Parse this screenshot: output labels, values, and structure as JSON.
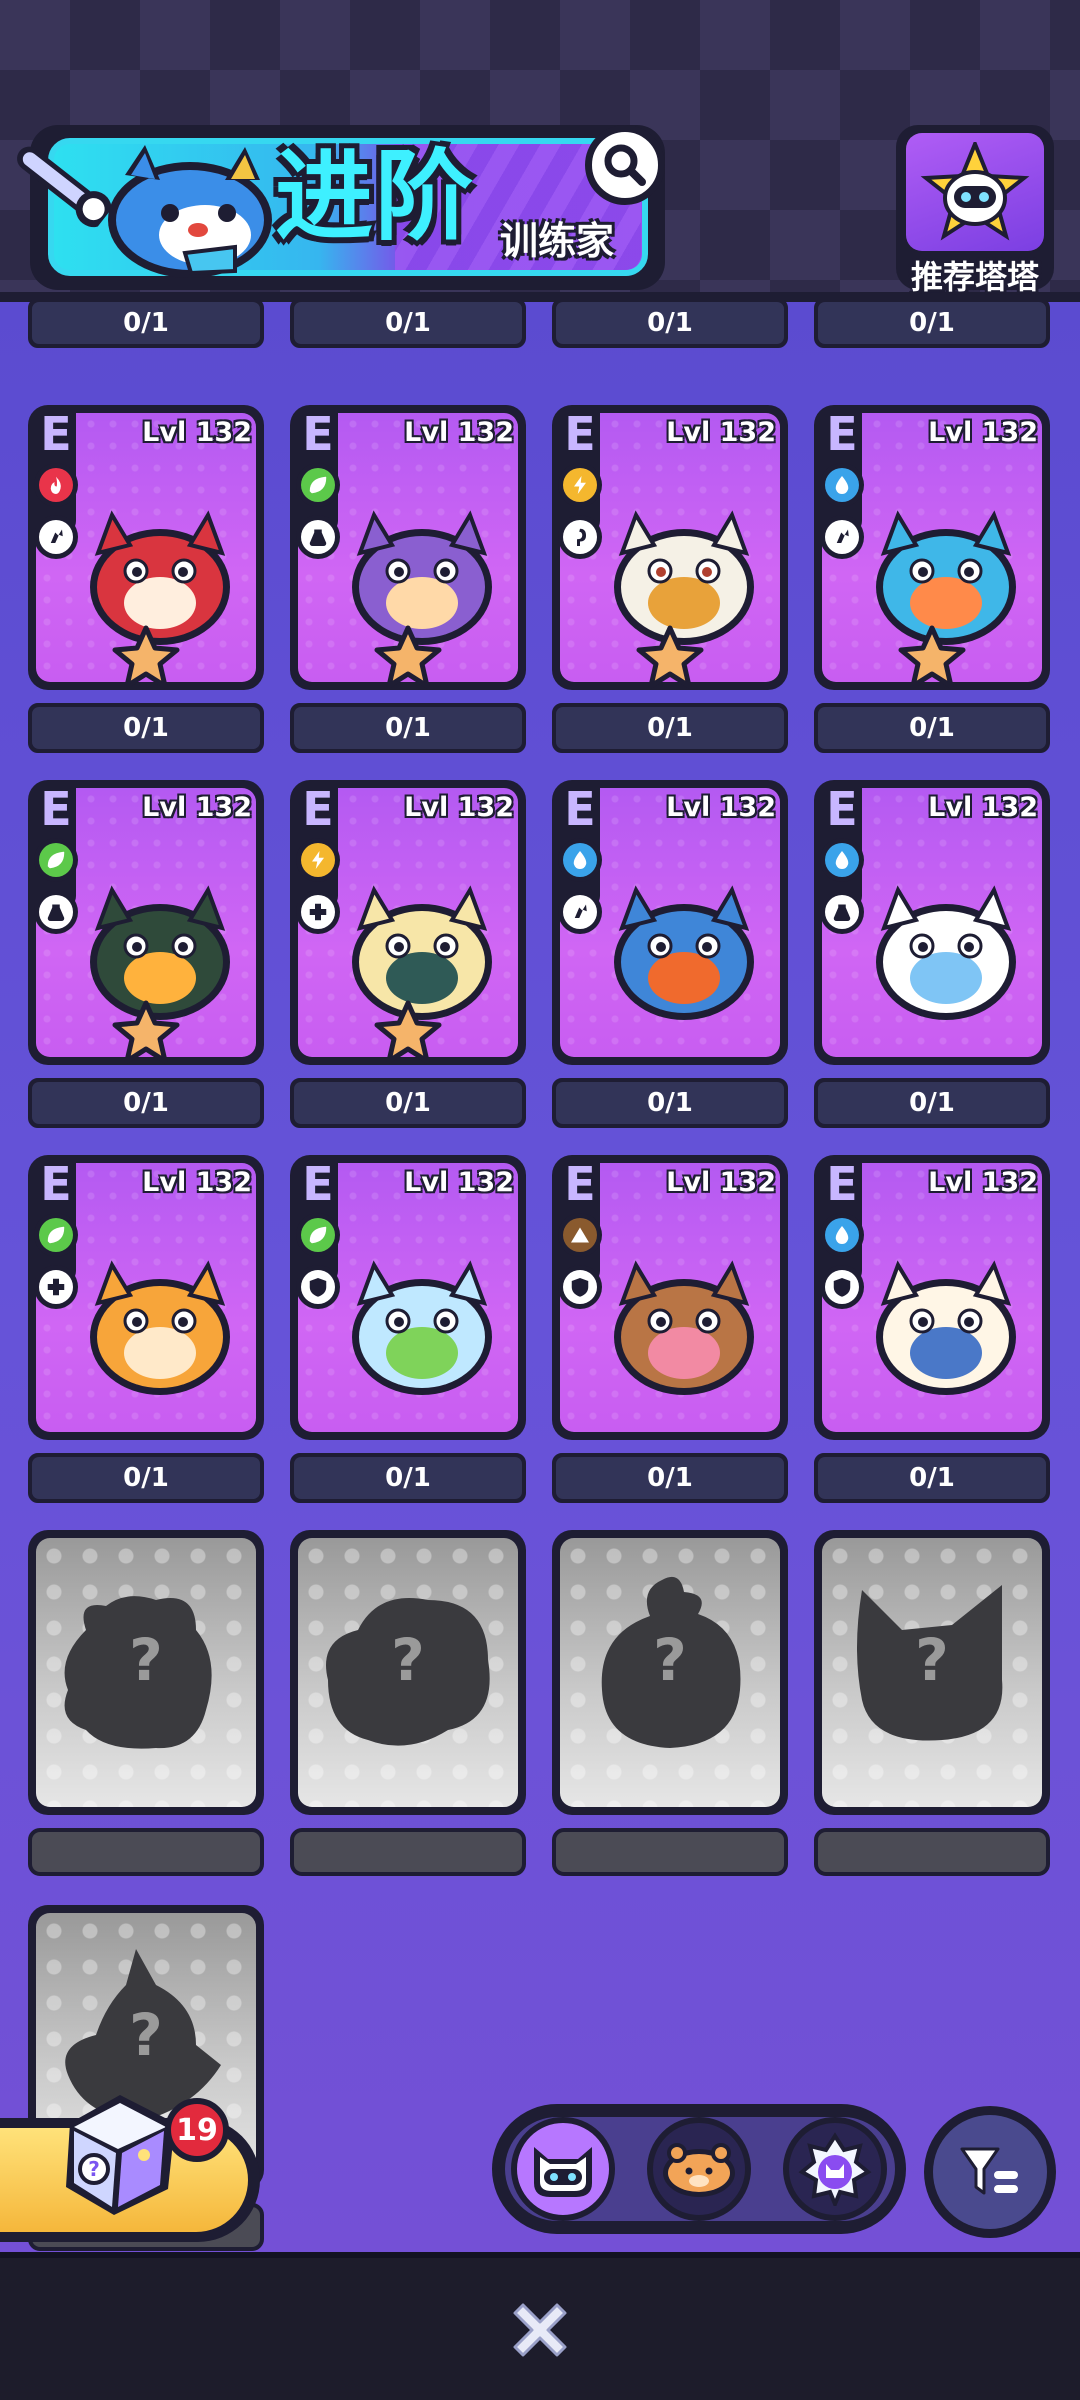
{
  "header": {
    "title": "进阶",
    "subtitle": "训练家",
    "search_icon": "magnifier-icon",
    "recommend_label": "推荐塔塔"
  },
  "top_partial_counts": [
    "0/1",
    "0/1",
    "0/1",
    "0/1"
  ],
  "cards": [
    {
      "grade": "E",
      "level": "Lvl 132",
      "element": "fire",
      "element_color": "#e9344a",
      "role": "attack",
      "count": "0/1",
      "creature": "red-panda",
      "has_star": true
    },
    {
      "grade": "E",
      "level": "Lvl 132",
      "element": "leaf",
      "element_color": "#5cc94a",
      "role": "potion",
      "count": "0/1",
      "creature": "mushroom",
      "has_star": true
    },
    {
      "grade": "E",
      "level": "Lvl 132",
      "element": "lightning",
      "element_color": "#f4b72e",
      "role": "magic",
      "count": "0/1",
      "creature": "lucky-cat",
      "has_star": true
    },
    {
      "grade": "E",
      "level": "Lvl 132",
      "element": "water",
      "element_color": "#3aa3ea",
      "role": "attack",
      "count": "0/1",
      "creature": "octopus",
      "has_star": true
    },
    {
      "grade": "E",
      "level": "Lvl 132",
      "element": "leaf",
      "element_color": "#5cc94a",
      "role": "potion",
      "count": "0/1",
      "creature": "owl",
      "has_star": true
    },
    {
      "grade": "E",
      "level": "Lvl 132",
      "element": "lightning",
      "element_color": "#f4b72e",
      "role": "heal",
      "count": "0/1",
      "creature": "bee",
      "has_star": true
    },
    {
      "grade": "E",
      "level": "Lvl 132",
      "element": "water",
      "element_color": "#3aa3ea",
      "role": "attack",
      "count": "0/1",
      "creature": "blue-cat",
      "has_star": false
    },
    {
      "grade": "E",
      "level": "Lvl 132",
      "element": "water",
      "element_color": "#3aa3ea",
      "role": "potion",
      "count": "0/1",
      "creature": "ghost-bunny",
      "has_star": false
    },
    {
      "grade": "E",
      "level": "Lvl 132",
      "element": "leaf",
      "element_color": "#5cc94a",
      "role": "heal",
      "count": "0/1",
      "creature": "sunflower",
      "has_star": false
    },
    {
      "grade": "E",
      "level": "Lvl 132",
      "element": "leaf",
      "element_color": "#5cc94a",
      "role": "defense",
      "count": "0/1",
      "creature": "slime-jar",
      "has_star": false
    },
    {
      "grade": "E",
      "level": "Lvl 132",
      "element": "earth",
      "element_color": "#8a5a2e",
      "role": "defense",
      "count": "0/1",
      "creature": "bear",
      "has_star": false
    },
    {
      "grade": "E",
      "level": "Lvl 132",
      "element": "water",
      "element_color": "#3aa3ea",
      "role": "defense",
      "count": "0/1",
      "creature": "polar-bear",
      "has_star": false
    }
  ],
  "locked_cards": [
    {
      "label": "?",
      "silhouette": "bear-silhouette"
    },
    {
      "label": "?",
      "silhouette": "blob-silhouette"
    },
    {
      "label": "?",
      "silhouette": "sprout-silhouette"
    },
    {
      "label": "?",
      "silhouette": "cat-silhouette"
    },
    {
      "label": "?",
      "silhouette": "witch-silhouette"
    }
  ],
  "bottom": {
    "dice_count": "19",
    "filter_tabs": [
      {
        "icon": "cat-face-icon",
        "active": true
      },
      {
        "icon": "hamster-icon",
        "active": false
      },
      {
        "icon": "star-badge-icon",
        "active": false
      }
    ],
    "sort_icon": "sort-filter-icon",
    "close_icon": "close-icon"
  },
  "colors": {
    "card_purple": "#c85df1",
    "outline": "#1e1d33",
    "background": "#6553d8"
  }
}
